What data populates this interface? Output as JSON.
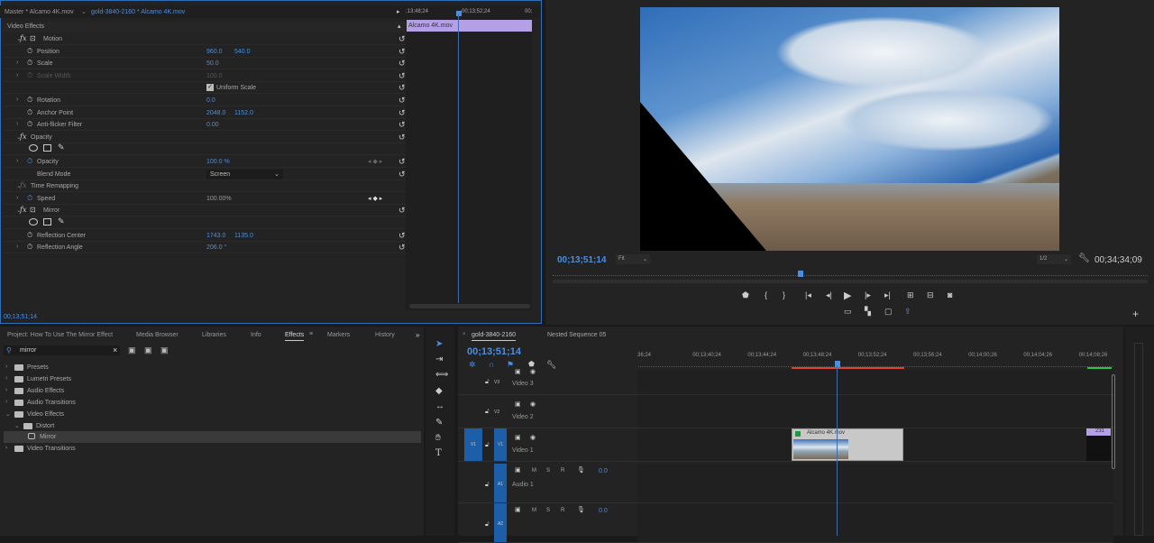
{
  "effect_controls": {
    "tab_master": "Master * Alcamo 4K.mov",
    "tab_clip": "gold-3840-2160 * Alcamo 4K.mov",
    "section": "Video Effects",
    "mini_timeline": {
      "t1": ";13;48;24",
      "t2": "00;13;52;24",
      "t3": "00;",
      "clip": "Alcamo 4K.mov"
    },
    "rows": [
      {
        "type": "fx",
        "label": "Motion"
      },
      {
        "type": "prop",
        "label": "Position",
        "v1": "960.0",
        "v2": "540.0"
      },
      {
        "type": "prop",
        "label": "Scale",
        "v1": "50.0",
        "chev": true
      },
      {
        "type": "prop",
        "label": "Scale Width",
        "v1": "100.0",
        "chev": true,
        "disabled": true
      },
      {
        "type": "check",
        "label": "Uniform Scale"
      },
      {
        "type": "prop",
        "label": "Rotation",
        "v1": "0.0",
        "chev": true
      },
      {
        "type": "prop",
        "label": "Anchor Point",
        "v1": "2048.0",
        "v2": "1152.0"
      },
      {
        "type": "prop",
        "label": "Anti-flicker Filter",
        "v1": "0.00",
        "chev": true
      },
      {
        "type": "fx",
        "label": "Opacity",
        "noicon": true
      },
      {
        "type": "masks"
      },
      {
        "type": "prop",
        "label": "Opacity",
        "v1": "100.0 %",
        "chev": true,
        "kf": true,
        "active": true
      },
      {
        "type": "prop",
        "label": "Blend Mode",
        "v1": "Screen",
        "select": true,
        "nosw": true
      },
      {
        "type": "fx",
        "label": "Time Remapping",
        "noicon": true,
        "noreset": true
      },
      {
        "type": "prop",
        "label": "Speed",
        "v1": "100.00%",
        "chev": true,
        "kf": true,
        "active": true,
        "noreset": true,
        "grey": true
      },
      {
        "type": "fx",
        "label": "Mirror"
      },
      {
        "type": "masks"
      },
      {
        "type": "prop",
        "label": "Reflection Center",
        "v1": "1743.0",
        "v2": "1135.0"
      },
      {
        "type": "prop",
        "label": "Reflection Angle",
        "v1": "206.0 °",
        "chev": true
      }
    ],
    "timecode": "00;13;51;14"
  },
  "program": {
    "timecode": "00;13;51;14",
    "zoom": "Fit",
    "resolution": "1/2",
    "duration": "00;34;34;09",
    "playhead_fraction": 0.4
  },
  "project": {
    "tabs": [
      "Project: How To Use The Mirror Effect",
      "Media Browser",
      "Libraries",
      "Info",
      "Effects",
      "Markers",
      "History"
    ],
    "active_tab": "Effects",
    "search": "mirror",
    "tree": [
      {
        "label": "Presets",
        "depth": 0,
        "open": false
      },
      {
        "label": "Lumetri Presets",
        "depth": 0,
        "open": false
      },
      {
        "label": "Audio Effects",
        "depth": 0,
        "open": false
      },
      {
        "label": "Audio Transitions",
        "depth": 0,
        "open": false
      },
      {
        "label": "Video Effects",
        "depth": 0,
        "open": true
      },
      {
        "label": "Distort",
        "depth": 1,
        "open": true
      },
      {
        "label": "Mirror",
        "depth": 2,
        "effect": true
      },
      {
        "label": "Video Transitions",
        "depth": 0,
        "open": false
      }
    ]
  },
  "timeline": {
    "tabs": [
      "gold-3840-2160",
      "Nested Sequence 05"
    ],
    "timecode": "00;13;51;14",
    "ticks": [
      "36;24",
      "00;13;40;24",
      "00;13;44;24",
      "00;13;48;24",
      "00;13;52;24",
      "00;13;56;24",
      "00;14;00;26",
      "00;14;04;26",
      "00;14;08;26"
    ],
    "video_tracks": [
      {
        "id": "V3",
        "name": "Video 3"
      },
      {
        "id": "V2",
        "name": "Video 2"
      },
      {
        "id": "V1",
        "name": "Video 1",
        "src": "V1"
      }
    ],
    "audio_tracks": [
      {
        "id": "A1",
        "name": "Audio 1",
        "vol": "0.0"
      },
      {
        "id": "A2",
        "name": "",
        "vol": "0.0"
      }
    ],
    "clip": "Alcamo 4K.mov",
    "clip2": "231",
    "audio_buttons": [
      "M",
      "S",
      "R"
    ]
  },
  "colors": {
    "accent": "#4a8fe0",
    "clip": "#b4a0e6",
    "in_out": "#e0432f",
    "render_green": "#2fbf4a"
  }
}
